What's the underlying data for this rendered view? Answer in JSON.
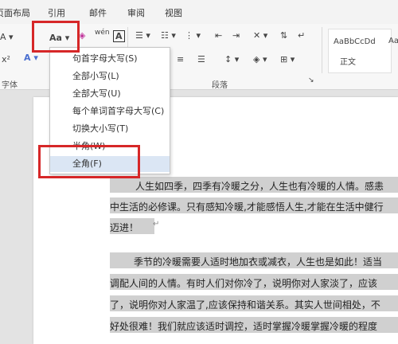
{
  "tabs": [
    "页面布局",
    "引用",
    "邮件",
    "审阅",
    "视图"
  ],
  "ribbon": {
    "change_case_label": "Aa",
    "phonetic_label": "wén",
    "char_border_label": "A",
    "font_group_label": "字体",
    "paragraph_group_label": "段落",
    "style_preview_1": "AaBbCcDd",
    "style_name_1": "正文",
    "style_preview_2": "Aa"
  },
  "menu": {
    "items": [
      "句首字母大写(S)",
      "全部小写(L)",
      "全部大写(U)",
      "每个单词首字母大写(C)",
      "切换大小写(T)",
      "半角(W)",
      "全角(F)"
    ],
    "selected_index": 6
  },
  "document": {
    "lines": [
      "人生如四季，四季有冷暖之分，人生也有冷暖的人情。感恚",
      "中生活的必修课。只有感知冷暖,才能感悟人生,才能在生活中健行",
      "迈进！",
      "季节的冷暖需要人适时地加衣或减衣，人生也是如此！适当",
      "调配人间的人情。有时人们对你冷了，说明你对人家淡了，应该",
      "了，说明你对人家温了,应该保持和谐关系。其实人世间相处，不",
      "好处很难！我们就应该适时调控，适时掌握冷暖掌握冷暖的程度"
    ]
  },
  "colors": {
    "highlight_box": "#d62728",
    "selection": "#d0d0d0"
  }
}
